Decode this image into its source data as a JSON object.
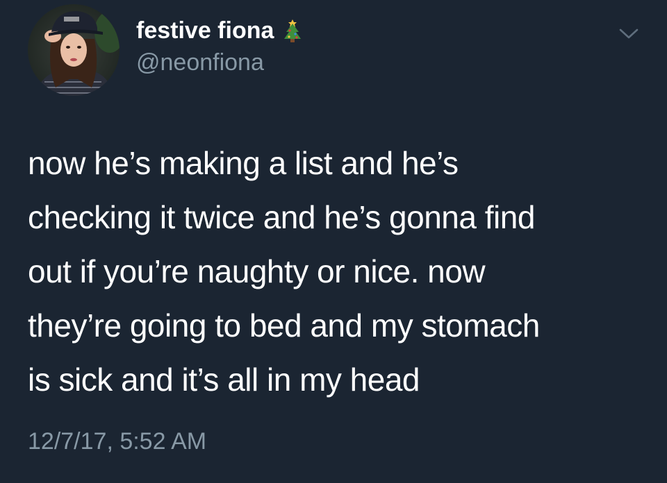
{
  "theme": {
    "background": "#1b2532",
    "text_primary": "#ffffff",
    "text_secondary": "#8899a6"
  },
  "author": {
    "display_name": "festive fiona",
    "name_emoji": "christmas-tree-icon",
    "handle": "@neonfiona",
    "avatar": "profile-photo"
  },
  "tweet": {
    "lines": [
      "now he’s making a list and he’s",
      "checking it twice and he’s gonna find",
      "out if you’re naughty or nice. now",
      "they’re going to bed and my stomach",
      "is sick and it’s all in my head"
    ],
    "timestamp": "12/7/17, 5:52 AM"
  },
  "menu": {
    "icon": "chevron-down-icon"
  }
}
